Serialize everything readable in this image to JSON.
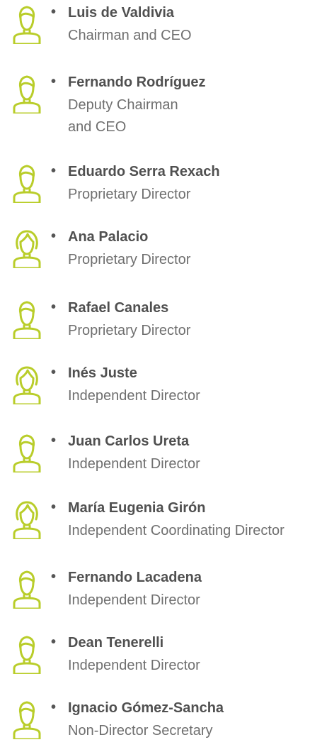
{
  "colors": {
    "icon": "#b9cd2a",
    "name": "#505050",
    "role": "#6f6f6f"
  },
  "bullet_char": "•",
  "members": [
    {
      "name": "Luis de Valdivia",
      "role_lines": [
        "Chairman and CEO"
      ],
      "icon": "person-male-icon"
    },
    {
      "name": "Fernando Rodríguez",
      "role_lines": [
        "Deputy Chairman",
        "and CEO"
      ],
      "icon": "person-male-icon"
    },
    {
      "name": "Eduardo Serra Rexach",
      "role_lines": [
        "Proprietary Director"
      ],
      "icon": "person-male-icon"
    },
    {
      "name": "Ana Palacio",
      "role_lines": [
        "Proprietary Director"
      ],
      "icon": "person-female-icon"
    },
    {
      "name": "Rafael Canales",
      "role_lines": [
        "Proprietary Director"
      ],
      "icon": "person-male-icon"
    },
    {
      "name": "Inés Juste",
      "role_lines": [
        "Independent Director"
      ],
      "icon": "person-female-icon"
    },
    {
      "name": "Juan Carlos Ureta",
      "role_lines": [
        "Independent Director"
      ],
      "icon": "person-male-icon"
    },
    {
      "name": "María Eugenia Girón",
      "role_lines": [
        "Independent Coordinating Director"
      ],
      "icon": "person-female-icon"
    },
    {
      "name": "Fernando Lacadena",
      "role_lines": [
        "Independent Director"
      ],
      "icon": "person-male-icon"
    },
    {
      "name": "Dean Tenerelli",
      "role_lines": [
        "Independent Director"
      ],
      "icon": "person-male-icon"
    },
    {
      "name": "Ignacio Gómez-Sancha",
      "role_lines": [
        "Non-Director Secretary"
      ],
      "icon": "person-male-icon"
    }
  ]
}
